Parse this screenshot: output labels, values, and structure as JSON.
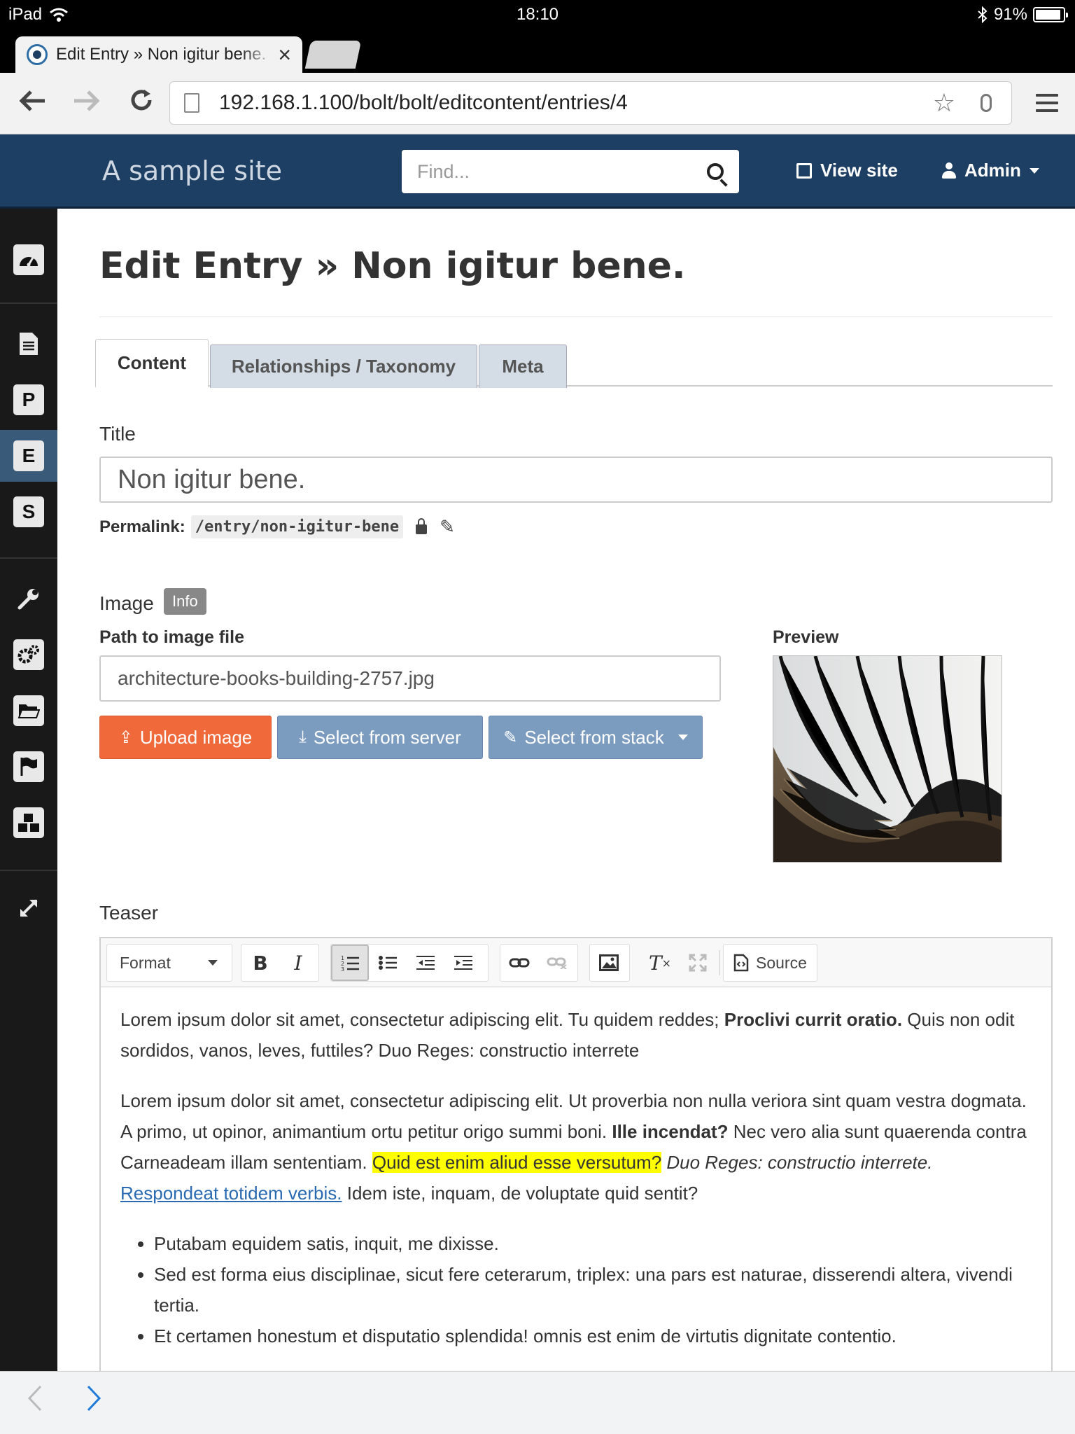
{
  "status_bar": {
    "device": "iPad",
    "time": "18:10",
    "battery_pct": "91%",
    "battery_level": 0.91
  },
  "browser": {
    "tab_title": "Edit Entry » Non igitur bene.",
    "url": "192.168.1.100/bolt/bolt/editcontent/entries/4"
  },
  "navbar": {
    "site_name": "A sample site",
    "search_placeholder": "Find...",
    "view_site": "View site",
    "user": "Admin"
  },
  "sidebar": {
    "items": [
      {
        "name": "dashboard",
        "icon": "dashboard-icon"
      },
      {
        "name": "overview",
        "icon": "document-icon"
      },
      {
        "name": "pages",
        "letter": "P"
      },
      {
        "name": "entries",
        "letter": "E",
        "active": true
      },
      {
        "name": "showcases",
        "letter": "S"
      },
      {
        "name": "configuration",
        "icon": "wrench-icon"
      },
      {
        "name": "settings",
        "icon": "cogs-icon"
      },
      {
        "name": "files",
        "icon": "folder-icon"
      },
      {
        "name": "translations",
        "icon": "flag-icon"
      },
      {
        "name": "extensions",
        "icon": "cubes-icon"
      },
      {
        "name": "expand",
        "icon": "expand-icon"
      }
    ]
  },
  "page": {
    "title_prefix": "Edit Entry",
    "title_sep": "»",
    "title_name": "Non igitur bene."
  },
  "tabs": [
    "Content",
    "Relationships / Taxonomy",
    "Meta"
  ],
  "fields": {
    "title_label": "Title",
    "title_value": "Non igitur bene.",
    "permalink_label": "Permalink:",
    "permalink_value": "/entry/non-igitur-bene",
    "image_label": "Image",
    "image_badge": "Info",
    "path_label": "Path to image file",
    "path_value": "architecture-books-building-2757.jpg",
    "preview_label": "Preview",
    "upload_btn": "Upload image",
    "server_btn": "Select from server",
    "stack_btn": "Select from stack",
    "teaser_label": "Teaser"
  },
  "editor": {
    "format_label": "Format",
    "source_label": "Source",
    "p1": {
      "a": "Lorem ipsum dolor sit amet, consectetur adipiscing elit. Tu quidem reddes; ",
      "b": "Proclivi currit oratio.",
      "c": " Quis non odit sordidos, vanos, leves, futtiles? Duo Reges: constructio interrete"
    },
    "p2": {
      "a": "Lorem ipsum dolor sit amet, consectetur adipiscing elit. Ut proverbia non nulla veriora sint quam vestra dogmata. A primo, ut opinor, animantium ortu petitur origo summi boni. ",
      "b": "Ille incendat?",
      "c": " Nec vero alia sunt quaerenda contra Carneadeam illam sententiam. ",
      "hl": "Quid est enim aliud esse versutum?",
      "d": " ",
      "em": "Duo Reges: constructio interrete.",
      "e": " ",
      "link": "Respondeat totidem verbis.",
      "f": " Idem iste, inquam, de voluptate quid sentit?"
    },
    "list": [
      "Putabam equidem satis, inquit, me dixisse.",
      "Sed est forma eius disciplinae, sicut fere ceterarum, triplex: una pars est naturae, disserendi altera, vivendi tertia.",
      "Et certamen honestum et disputatio splendida! omnis est enim de virtutis dignitate contentio."
    ]
  },
  "colors": {
    "navbar": "#1d3f63",
    "sidebar": "#191919",
    "sidebar_active": "#3a5a7a",
    "upload_orange": "#f0693a",
    "select_blue": "#7c9cbf",
    "highlight": "#ffff00"
  }
}
